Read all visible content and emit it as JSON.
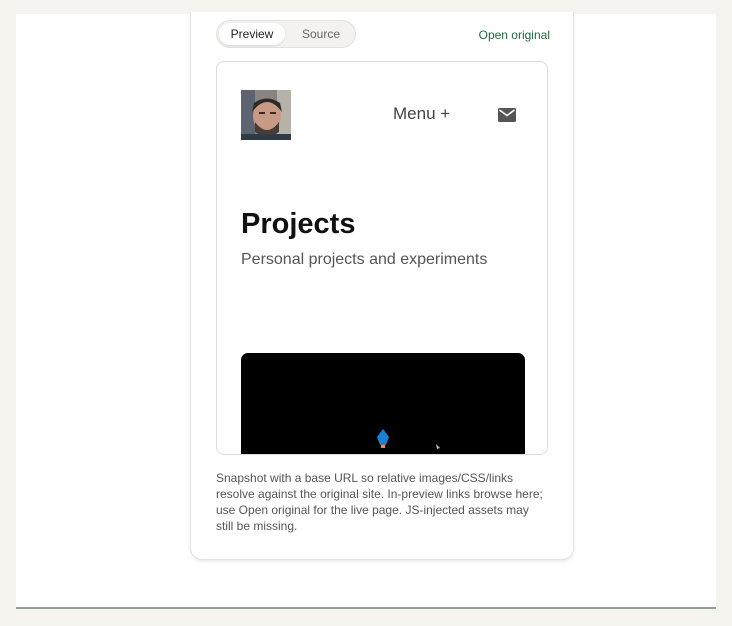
{
  "tabs": [
    {
      "label": "Preview",
      "active": true
    },
    {
      "label": "Source",
      "active": false
    }
  ],
  "open_original_label": "Open original",
  "preview": {
    "menu_label": "Menu +",
    "title": "Projects",
    "subtitle": "Personal projects and experiments"
  },
  "caption": "Snapshot with a base URL so relative images/CSS/links resolve against the original site. In-preview links browse here; use Open original for the live page. JS-injected assets may still be missing.",
  "icons": {
    "mail": "mail-icon",
    "avatar": "avatar-photo",
    "rocket": "rocket-sprite",
    "cursor": "cursor-sprite"
  },
  "colors": {
    "page_bg": "#f4f3ee",
    "link_green": "#1f6b3a",
    "video_bg": "#000000"
  }
}
